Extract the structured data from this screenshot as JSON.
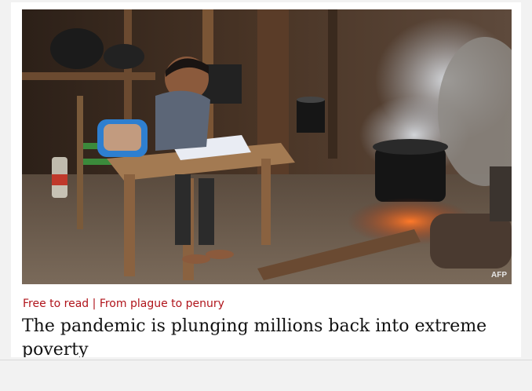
{
  "article": {
    "image_credit": "AFP",
    "kicker_free": "Free to read",
    "kicker_separator": " | ",
    "kicker_section": "From plague to penury",
    "headline": "The pandemic is plunging millions back into extreme poverty"
  },
  "colors": {
    "kicker": "#b0141b",
    "headline": "#111111"
  }
}
